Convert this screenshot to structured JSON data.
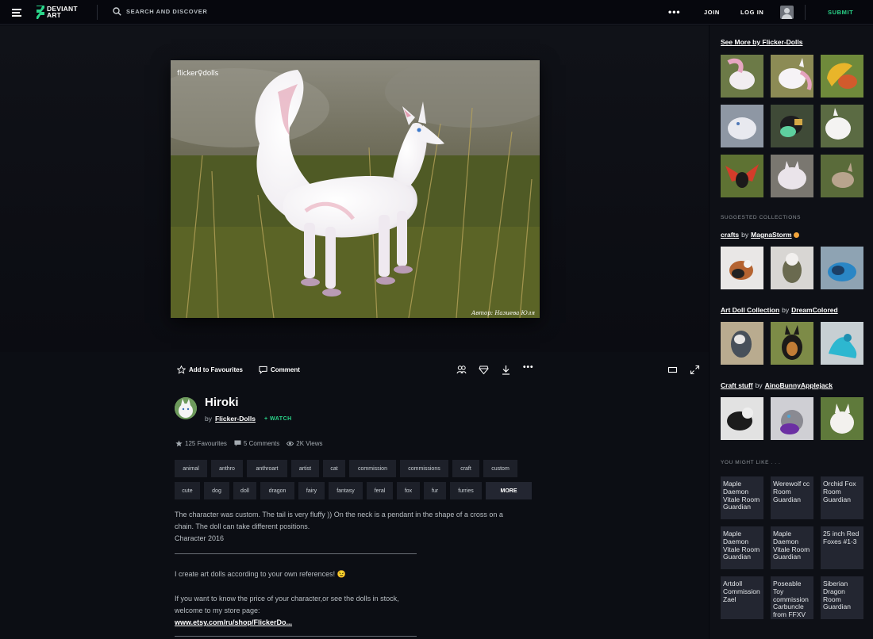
{
  "colors": {
    "accent": "#2ad489",
    "bg": "#06070d",
    "panel": "#0e1016",
    "tag_bg": "#1d2029",
    "badge": "#f3a53b"
  },
  "header": {
    "logo_lines": [
      "DEVIANT",
      "ART"
    ],
    "search_placeholder": "SEARCH AND DISCOVER",
    "more": "•••",
    "join": "JOIN",
    "login": "LOG IN",
    "submit": "SUBMIT"
  },
  "artwork": {
    "watermark": "flicker♀dolls",
    "credit": "Автор: Назиева Юля"
  },
  "actions": {
    "favourite": "Add to Favourites",
    "comment": "Comment",
    "icons": [
      "people-icon",
      "badge-icon",
      "download-icon",
      "more-icon",
      "theater-mode-icon",
      "fullscreen-icon"
    ],
    "more": "•••"
  },
  "deviation": {
    "title": "Hiroki",
    "by": "by",
    "author": "Flicker-Dolls",
    "watch": "+ WATCH",
    "favourites": "125 Favourites",
    "comments": "5 Comments",
    "views": "2K Views"
  },
  "tags_row1": [
    "animal",
    "anthro",
    "anthroart",
    "artist",
    "cat",
    "commission",
    "commissions",
    "craft",
    "custom"
  ],
  "tags_row2": [
    "cute",
    "dog",
    "doll",
    "dragon",
    "fairy",
    "fantasy",
    "feral",
    "fox",
    "fur",
    "furries"
  ],
  "tags_more": "MORE",
  "description": {
    "line1": "The character was custom. The tail is very fluffy )) On the neck is a pendant in the shape of a cross on a",
    "line2": "chain. The doll can take different positions.",
    "line3": "Character 2016",
    "line4": "I create art dolls according to your own references! 😉",
    "line5": "If you want to know the price of your character,or see the dolls in stock,",
    "line6": "welcome to my store page:",
    "link": "www.etsy.com/ru/shop/FlickerDo..."
  },
  "sidebar": {
    "see_more": "See More by Flicker-Dolls",
    "suggested_label": "SUGGESTED COLLECTIONS",
    "collections": [
      {
        "title": "crafts",
        "by": "by",
        "owner": "MagnaStorm"
      },
      {
        "title": "Art Doll Collection",
        "by": "by",
        "owner": "DreamColored"
      },
      {
        "title": "Craft stuff",
        "by": "by",
        "owner": "AinoBunnyApplejack"
      }
    ],
    "you_might_like_label": "YOU MIGHT LIKE . . .",
    "you_might_like": [
      "Maple Daemon Vitale Room Guardian",
      "Werewolf cc Room Guardian",
      "Orchid Fox Room Guardian",
      "Maple Daemon Vitale Room Guardian",
      "Maple Daemon Vitale Room Guardian",
      "25 inch Red Foxes #1-3",
      "Artdoll Commission Zael",
      "Poseable Toy commission Carbuncle from FFXV",
      "Siberian Dragon Room Guardian"
    ]
  }
}
